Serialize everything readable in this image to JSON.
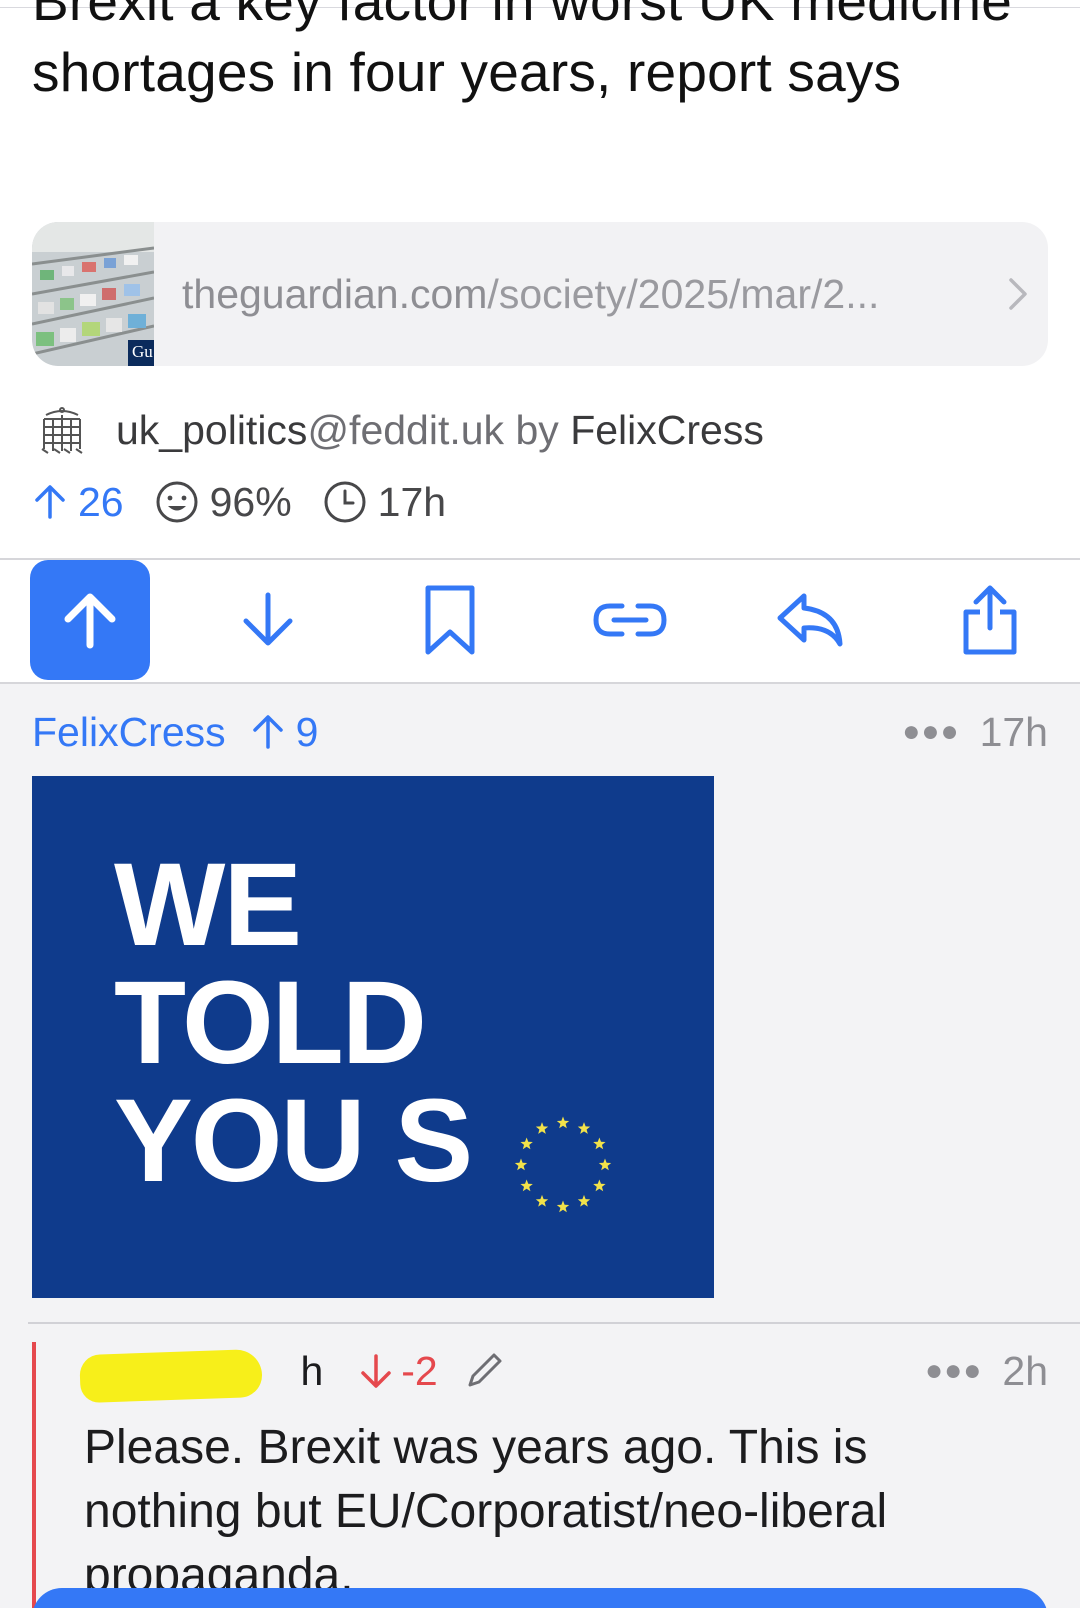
{
  "post": {
    "title": "Brexit a key factor in worst UK medicine shortages in four years, report says",
    "link": {
      "domain": "theguardian.com",
      "path": "/society/2025/mar/2...",
      "thumb_badge": "Gu"
    },
    "community": "uk_politics",
    "instance": "@feddit.uk",
    "by_label": "by",
    "author": "FelixCress",
    "upvotes": "26",
    "upvote_ratio": "96%",
    "age": "17h"
  },
  "actions": {
    "upvote": "upvote",
    "downvote": "downvote",
    "save": "save",
    "copy_link": "copy-link",
    "reply": "reply",
    "share": "share"
  },
  "comment": {
    "author": "FelixCress",
    "score": "9",
    "age": "17h",
    "image_lines": [
      "WE",
      "TOLD",
      "YOU S"
    ],
    "image_colors": {
      "background": "#0f3b8c",
      "stars": "#f2e24a"
    }
  },
  "reply": {
    "author_visible": "d                 h",
    "score": "-2",
    "age": "2h",
    "body": "Please. Brexit was years ago. This is nothing but EU/Corporatist/neo-liberal propaganda."
  },
  "colors": {
    "accent": "#3478f6",
    "downvote": "#e5484d",
    "muted": "#8e8e93"
  }
}
